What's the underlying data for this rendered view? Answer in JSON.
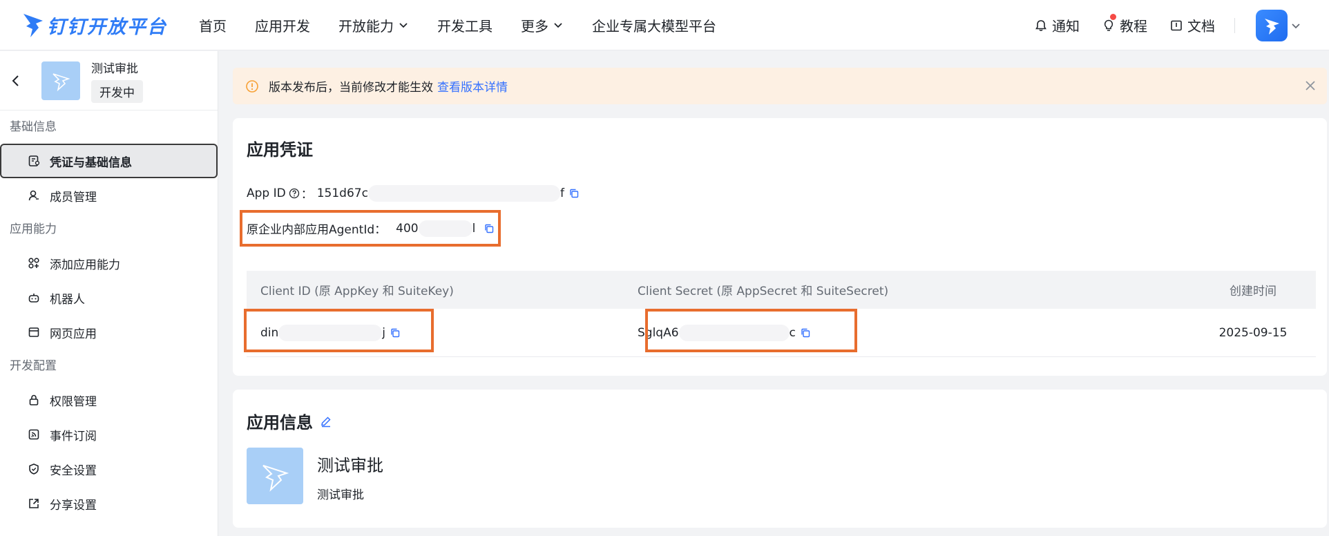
{
  "brand": {
    "name": "钉钉开放平台"
  },
  "nav": {
    "items": [
      {
        "label": "首页",
        "has_dropdown": false
      },
      {
        "label": "应用开发",
        "has_dropdown": false
      },
      {
        "label": "开放能力",
        "has_dropdown": true
      },
      {
        "label": "开发工具",
        "has_dropdown": false
      },
      {
        "label": "更多",
        "has_dropdown": true
      },
      {
        "label": "企业专属大模型平台",
        "has_dropdown": false
      }
    ],
    "right": {
      "notify": "通知",
      "tutorial": "教程",
      "docs": "文档"
    }
  },
  "sidebar": {
    "app_name": "测试审批",
    "app_status": "开发中",
    "groups": [
      {
        "label": "基础信息",
        "items": [
          {
            "label": "凭证与基础信息",
            "icon": "credential-icon",
            "active": true
          },
          {
            "label": "成员管理",
            "icon": "user-icon",
            "active": false
          }
        ]
      },
      {
        "label": "应用能力",
        "items": [
          {
            "label": "添加应用能力",
            "icon": "apps-add-icon",
            "active": false
          },
          {
            "label": "机器人",
            "icon": "robot-icon",
            "active": false
          },
          {
            "label": "网页应用",
            "icon": "webpage-icon",
            "active": false
          }
        ]
      },
      {
        "label": "开发配置",
        "items": [
          {
            "label": "权限管理",
            "icon": "lock-icon",
            "active": false
          },
          {
            "label": "事件订阅",
            "icon": "rss-icon",
            "active": false
          },
          {
            "label": "安全设置",
            "icon": "shield-icon",
            "active": false
          },
          {
            "label": "分享设置",
            "icon": "share-icon",
            "active": false
          }
        ]
      }
    ]
  },
  "notice": {
    "text": "版本发布后，当前修改才能生效",
    "link": "查看版本详情"
  },
  "credentials": {
    "title": "应用凭证",
    "app_id_label": "App ID",
    "app_id_sep": "：",
    "app_id_prefix": "151d67c",
    "app_id_suffix": "f",
    "agent_label": "原企业内部应用AgentId：",
    "agent_prefix": "400",
    "agent_suffix": "l",
    "table": {
      "headers": [
        "Client ID (原 AppKey 和 SuiteKey)",
        "Client Secret (原 AppSecret 和 SuiteSecret)",
        "创建时间"
      ],
      "client_id_prefix": "din",
      "client_id_suffix": "j",
      "client_secret_prefix": "SglqA6",
      "client_secret_suffix": "c",
      "created": "2025-09-15"
    }
  },
  "app_info": {
    "title": "应用信息",
    "name": "测试审批",
    "desc": "测试审批"
  },
  "colors": {
    "accent": "#3370ff",
    "highlight": "#e86d2e",
    "notice_bg": "#fdf0e3"
  }
}
